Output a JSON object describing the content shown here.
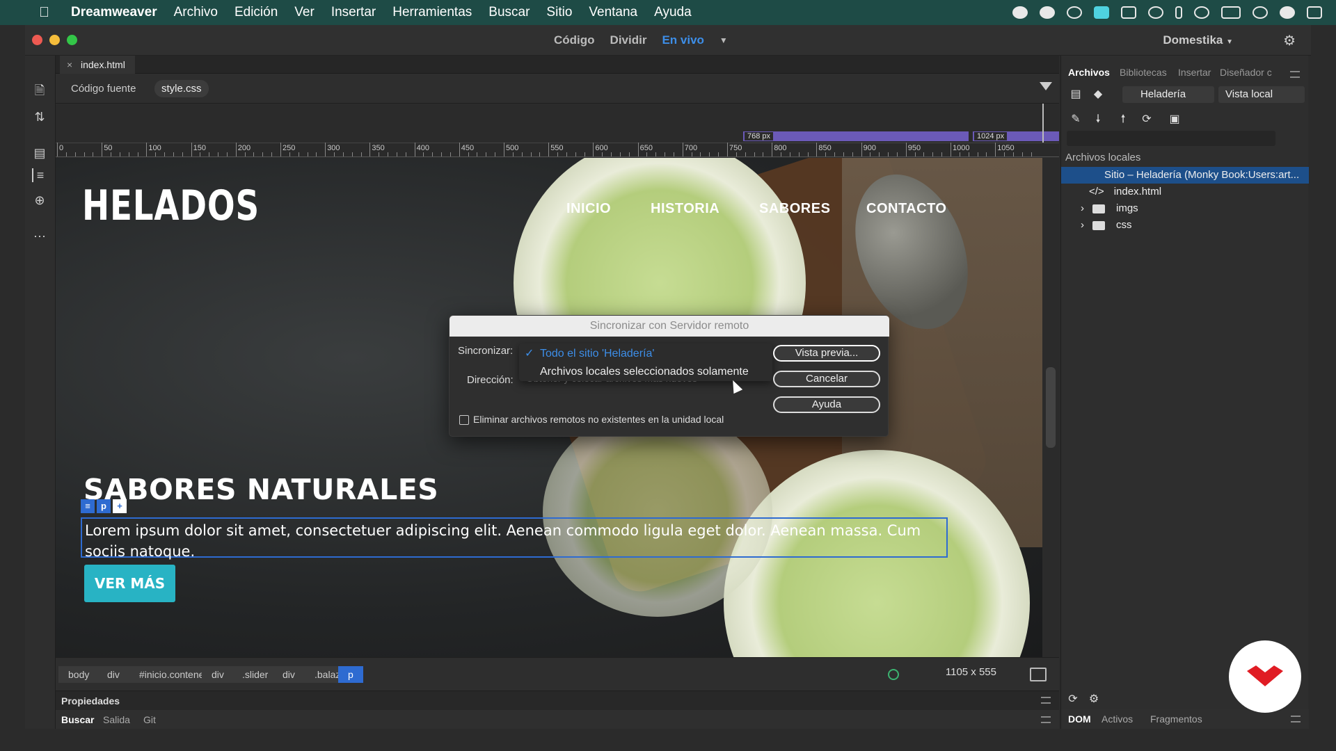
{
  "menubar": {
    "app": "Dreamweaver",
    "items": [
      "Archivo",
      "Edición",
      "Ver",
      "Insertar",
      "Herramientas",
      "Buscar",
      "Sitio",
      "Ventana",
      "Ayuda"
    ]
  },
  "titlebar": {
    "views": [
      "Código",
      "Dividir",
      "En vivo"
    ],
    "active_view": "En vivo",
    "workspace": "Domestika"
  },
  "document": {
    "tab": "index.html",
    "related": [
      "Código fuente",
      "style.css"
    ],
    "mq": [
      {
        "label": "768  px"
      },
      {
        "label": "1024  px"
      }
    ]
  },
  "ruler": {
    "ticks": [
      "0",
      "50",
      "100",
      "150",
      "200",
      "250",
      "300",
      "350",
      "400",
      "450",
      "500",
      "550",
      "600",
      "650",
      "700",
      "750",
      "800",
      "850",
      "900",
      "950",
      "1000",
      "1050"
    ]
  },
  "page": {
    "brand": "HELADOS",
    "nav": [
      "INICIO",
      "HISTORIA",
      "SABORES",
      "CONTACTO"
    ],
    "headline": "SABORES NATURALES",
    "tag": "p",
    "paragraph": "Lorem ipsum dolor sit amet, consectetuer adipiscing elit. Aenean commodo ligula eget dolor. Aenean massa. Cum sociis natoque.",
    "button": "VER MÁS"
  },
  "dialog": {
    "title": "Sincronizar con Servidor remoto",
    "sync_label": "Sincronizar:",
    "direction_label": "Dirección:",
    "options": [
      "Todo el sitio 'Heladería'",
      "Archivos locales seleccionados solamente"
    ],
    "selected_option": "Todo el sitio 'Heladería'",
    "direction_value": "Obtener y colocar archivos más nuevos",
    "checkbox_label": "Eliminar archivos remotos no existentes en la unidad local",
    "checkbox_checked": false,
    "buttons": [
      "Vista previa...",
      "Cancelar",
      "Ayuda"
    ]
  },
  "tagbar": {
    "crumbs": [
      "body",
      "div",
      "#inicio.contenedor",
      "div",
      ".slider",
      "div",
      ".balazo",
      "p"
    ],
    "selected": "p",
    "size": "1105 x 555"
  },
  "bottom": {
    "properties": "Propiedades",
    "tabs": [
      "Buscar",
      "Salida",
      "Git"
    ]
  },
  "panel": {
    "tabs": [
      "Archivos",
      "Bibliotecas",
      "Insertar",
      "Diseñador c"
    ],
    "site": "Heladería",
    "view": "Vista local",
    "local_label": "Archivos locales",
    "root": "Sitio – Heladería (Monky Book:Users:art...",
    "files": [
      "index.html",
      "imgs",
      "css"
    ],
    "bottom_tabs": [
      "DOM",
      "Activos",
      "Fragmentos"
    ]
  },
  "colors": {
    "accent": "#2e6bd1",
    "brand_button": "#28b3c4",
    "menubar": "#1e4b46",
    "logo": "#e01c24"
  }
}
